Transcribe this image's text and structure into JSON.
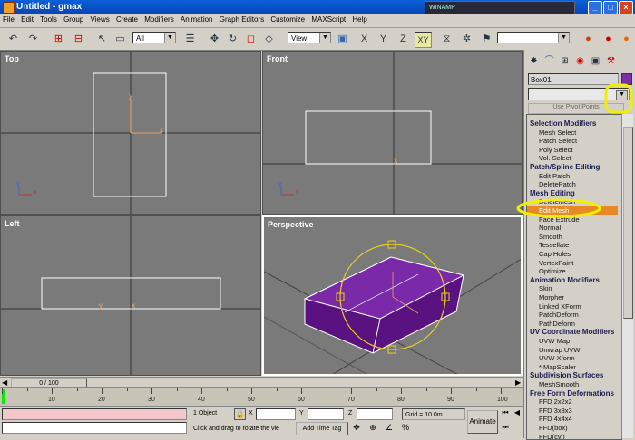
{
  "window": {
    "title": "Untitled - gmax",
    "winamp": "WINAMP",
    "min": "_",
    "max": "□",
    "close": "×"
  },
  "menu": [
    "File",
    "Edit",
    "Tools",
    "Group",
    "Views",
    "Create",
    "Modifiers",
    "Animation",
    "Graph Editors",
    "Customize",
    "MAXScript",
    "Help"
  ],
  "toolbar": {
    "selection_filter": "All",
    "ref_coord": "View",
    "axis_x": "X",
    "axis_y": "Y",
    "axis_z": "Z",
    "axis_xy": "XY"
  },
  "viewports": {
    "top": "Top",
    "front": "Front",
    "left": "Left",
    "perspective": "Perspective"
  },
  "axis_labels": {
    "x": "x",
    "y": "y"
  },
  "command_panel": {
    "object_name": "Box01",
    "object_color": "#7b2fa8",
    "use_pivot": "Use Pivot Points",
    "modifier_list": [
      {
        "type": "header",
        "text": "Selection Modifiers"
      },
      {
        "type": "item",
        "text": "Mesh Select"
      },
      {
        "type": "item",
        "text": "Patch Select"
      },
      {
        "type": "item",
        "text": "Poly Select"
      },
      {
        "type": "item",
        "text": "Vol. Select"
      },
      {
        "type": "header",
        "text": "Patch/Spline Editing"
      },
      {
        "type": "item",
        "text": "Edit Patch"
      },
      {
        "type": "item",
        "text": "DeletePatch"
      },
      {
        "type": "header",
        "text": "Mesh Editing"
      },
      {
        "type": "item",
        "text": "DeleteMesh"
      },
      {
        "type": "item",
        "text": "Edit Mesh",
        "selected": true
      },
      {
        "type": "item",
        "text": "Face Extrude"
      },
      {
        "type": "item",
        "text": "Normal"
      },
      {
        "type": "item",
        "text": "Smooth"
      },
      {
        "type": "item",
        "text": "Tessellate"
      },
      {
        "type": "item",
        "text": "Cap Holes"
      },
      {
        "type": "item",
        "text": "VertexPaint"
      },
      {
        "type": "item",
        "text": "Optimize"
      },
      {
        "type": "header",
        "text": "Animation Modifiers"
      },
      {
        "type": "item",
        "text": "Skin"
      },
      {
        "type": "item",
        "text": "Morpher"
      },
      {
        "type": "item",
        "text": "Linked XForm"
      },
      {
        "type": "item",
        "text": "PatchDeform"
      },
      {
        "type": "item",
        "text": "PathDeform"
      },
      {
        "type": "header",
        "text": "UV Coordinate Modifiers"
      },
      {
        "type": "item",
        "text": "UVW Map"
      },
      {
        "type": "item",
        "text": "Unwrap UVW"
      },
      {
        "type": "item",
        "text": "UVW Xform"
      },
      {
        "type": "item",
        "text": "* MapScaler"
      },
      {
        "type": "header",
        "text": "Subdivision Surfaces"
      },
      {
        "type": "item",
        "text": "MeshSmooth"
      },
      {
        "type": "header",
        "text": "Free Form Deformations"
      },
      {
        "type": "item",
        "text": "FFD 2x2x2"
      },
      {
        "type": "item",
        "text": "FFD 3x3x3"
      },
      {
        "type": "item",
        "text": "FFD 4x4x4"
      },
      {
        "type": "item",
        "text": "FFD(box)"
      },
      {
        "type": "item",
        "text": "FFD(cyl)"
      }
    ]
  },
  "timeline": {
    "slider_label": "0 / 100",
    "ticks": [
      "10",
      "20",
      "30",
      "40",
      "50",
      "60",
      "70",
      "80",
      "90",
      "100"
    ]
  },
  "status": {
    "selected": "1 Object",
    "prompt": "Click and drag to rotate the vie",
    "add_time_tag": "Add Time Tag",
    "x_label": "X",
    "y_label": "Y",
    "z_label": "Z",
    "grid": "Grid = 10.0m",
    "animate": "Animate"
  }
}
